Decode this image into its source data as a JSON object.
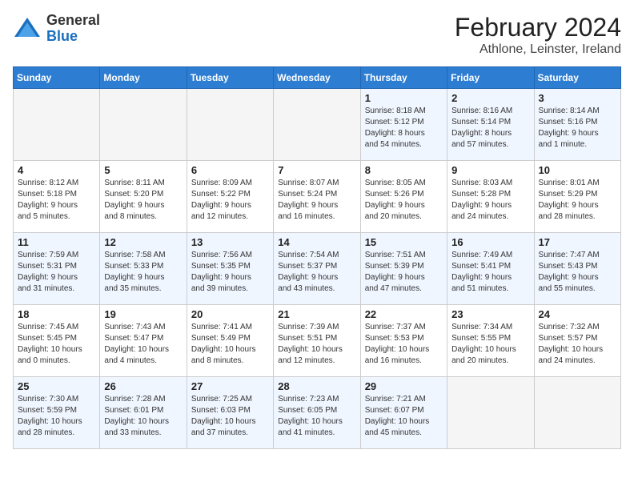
{
  "logo": {
    "general": "General",
    "blue": "Blue"
  },
  "title": "February 2024",
  "subtitle": "Athlone, Leinster, Ireland",
  "days_of_week": [
    "Sunday",
    "Monday",
    "Tuesday",
    "Wednesday",
    "Thursday",
    "Friday",
    "Saturday"
  ],
  "weeks": [
    [
      {
        "day": "",
        "info": ""
      },
      {
        "day": "",
        "info": ""
      },
      {
        "day": "",
        "info": ""
      },
      {
        "day": "",
        "info": ""
      },
      {
        "day": "1",
        "info": "Sunrise: 8:18 AM\nSunset: 5:12 PM\nDaylight: 8 hours\nand 54 minutes."
      },
      {
        "day": "2",
        "info": "Sunrise: 8:16 AM\nSunset: 5:14 PM\nDaylight: 8 hours\nand 57 minutes."
      },
      {
        "day": "3",
        "info": "Sunrise: 8:14 AM\nSunset: 5:16 PM\nDaylight: 9 hours\nand 1 minute."
      }
    ],
    [
      {
        "day": "4",
        "info": "Sunrise: 8:12 AM\nSunset: 5:18 PM\nDaylight: 9 hours\nand 5 minutes."
      },
      {
        "day": "5",
        "info": "Sunrise: 8:11 AM\nSunset: 5:20 PM\nDaylight: 9 hours\nand 8 minutes."
      },
      {
        "day": "6",
        "info": "Sunrise: 8:09 AM\nSunset: 5:22 PM\nDaylight: 9 hours\nand 12 minutes."
      },
      {
        "day": "7",
        "info": "Sunrise: 8:07 AM\nSunset: 5:24 PM\nDaylight: 9 hours\nand 16 minutes."
      },
      {
        "day": "8",
        "info": "Sunrise: 8:05 AM\nSunset: 5:26 PM\nDaylight: 9 hours\nand 20 minutes."
      },
      {
        "day": "9",
        "info": "Sunrise: 8:03 AM\nSunset: 5:28 PM\nDaylight: 9 hours\nand 24 minutes."
      },
      {
        "day": "10",
        "info": "Sunrise: 8:01 AM\nSunset: 5:29 PM\nDaylight: 9 hours\nand 28 minutes."
      }
    ],
    [
      {
        "day": "11",
        "info": "Sunrise: 7:59 AM\nSunset: 5:31 PM\nDaylight: 9 hours\nand 31 minutes."
      },
      {
        "day": "12",
        "info": "Sunrise: 7:58 AM\nSunset: 5:33 PM\nDaylight: 9 hours\nand 35 minutes."
      },
      {
        "day": "13",
        "info": "Sunrise: 7:56 AM\nSunset: 5:35 PM\nDaylight: 9 hours\nand 39 minutes."
      },
      {
        "day": "14",
        "info": "Sunrise: 7:54 AM\nSunset: 5:37 PM\nDaylight: 9 hours\nand 43 minutes."
      },
      {
        "day": "15",
        "info": "Sunrise: 7:51 AM\nSunset: 5:39 PM\nDaylight: 9 hours\nand 47 minutes."
      },
      {
        "day": "16",
        "info": "Sunrise: 7:49 AM\nSunset: 5:41 PM\nDaylight: 9 hours\nand 51 minutes."
      },
      {
        "day": "17",
        "info": "Sunrise: 7:47 AM\nSunset: 5:43 PM\nDaylight: 9 hours\nand 55 minutes."
      }
    ],
    [
      {
        "day": "18",
        "info": "Sunrise: 7:45 AM\nSunset: 5:45 PM\nDaylight: 10 hours\nand 0 minutes."
      },
      {
        "day": "19",
        "info": "Sunrise: 7:43 AM\nSunset: 5:47 PM\nDaylight: 10 hours\nand 4 minutes."
      },
      {
        "day": "20",
        "info": "Sunrise: 7:41 AM\nSunset: 5:49 PM\nDaylight: 10 hours\nand 8 minutes."
      },
      {
        "day": "21",
        "info": "Sunrise: 7:39 AM\nSunset: 5:51 PM\nDaylight: 10 hours\nand 12 minutes."
      },
      {
        "day": "22",
        "info": "Sunrise: 7:37 AM\nSunset: 5:53 PM\nDaylight: 10 hours\nand 16 minutes."
      },
      {
        "day": "23",
        "info": "Sunrise: 7:34 AM\nSunset: 5:55 PM\nDaylight: 10 hours\nand 20 minutes."
      },
      {
        "day": "24",
        "info": "Sunrise: 7:32 AM\nSunset: 5:57 PM\nDaylight: 10 hours\nand 24 minutes."
      }
    ],
    [
      {
        "day": "25",
        "info": "Sunrise: 7:30 AM\nSunset: 5:59 PM\nDaylight: 10 hours\nand 28 minutes."
      },
      {
        "day": "26",
        "info": "Sunrise: 7:28 AM\nSunset: 6:01 PM\nDaylight: 10 hours\nand 33 minutes."
      },
      {
        "day": "27",
        "info": "Sunrise: 7:25 AM\nSunset: 6:03 PM\nDaylight: 10 hours\nand 37 minutes."
      },
      {
        "day": "28",
        "info": "Sunrise: 7:23 AM\nSunset: 6:05 PM\nDaylight: 10 hours\nand 41 minutes."
      },
      {
        "day": "29",
        "info": "Sunrise: 7:21 AM\nSunset: 6:07 PM\nDaylight: 10 hours\nand 45 minutes."
      },
      {
        "day": "",
        "info": ""
      },
      {
        "day": "",
        "info": ""
      }
    ]
  ]
}
